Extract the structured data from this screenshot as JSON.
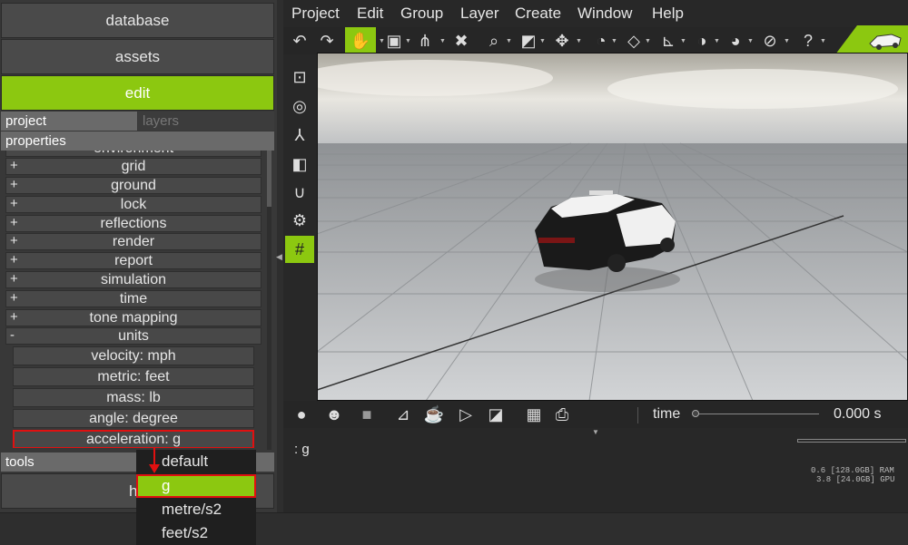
{
  "nav": {
    "database": "database",
    "assets": "assets",
    "edit": "edit",
    "help": "he"
  },
  "tabs": {
    "project": "project",
    "layers": "layers"
  },
  "sections": {
    "properties": "properties",
    "tools": "tools"
  },
  "properties": {
    "cut_item": "environment",
    "groups": [
      {
        "sign": "+",
        "label": "grid"
      },
      {
        "sign": "+",
        "label": "ground"
      },
      {
        "sign": "+",
        "label": "lock"
      },
      {
        "sign": "+",
        "label": "reflections"
      },
      {
        "sign": "+",
        "label": "render"
      },
      {
        "sign": "+",
        "label": "report"
      },
      {
        "sign": "+",
        "label": "simulation"
      },
      {
        "sign": "+",
        "label": "time"
      },
      {
        "sign": "+",
        "label": "tone mapping"
      },
      {
        "sign": "-",
        "label": "units"
      }
    ],
    "units": [
      "velocity: mph",
      "metric: feet",
      "mass: lb",
      "angle: degree",
      "acceleration: g"
    ]
  },
  "dropdown": {
    "options": [
      "default",
      "g",
      "metre/s2",
      "feet/s2"
    ],
    "selected": "g"
  },
  "menubar": [
    "Project",
    "Edit",
    "Group",
    "Layer",
    "Create",
    "Window",
    "Help"
  ],
  "viewport": {
    "time_label": "time",
    "time_value": "0.000 s"
  },
  "console": {
    "text": ": g",
    "ram": "0.6 [128.0GB] RAM",
    "gpu": "3.8 [24.0GB] GPU"
  },
  "colors": {
    "accent": "#8cc810",
    "highlight_border": "#e01010"
  }
}
